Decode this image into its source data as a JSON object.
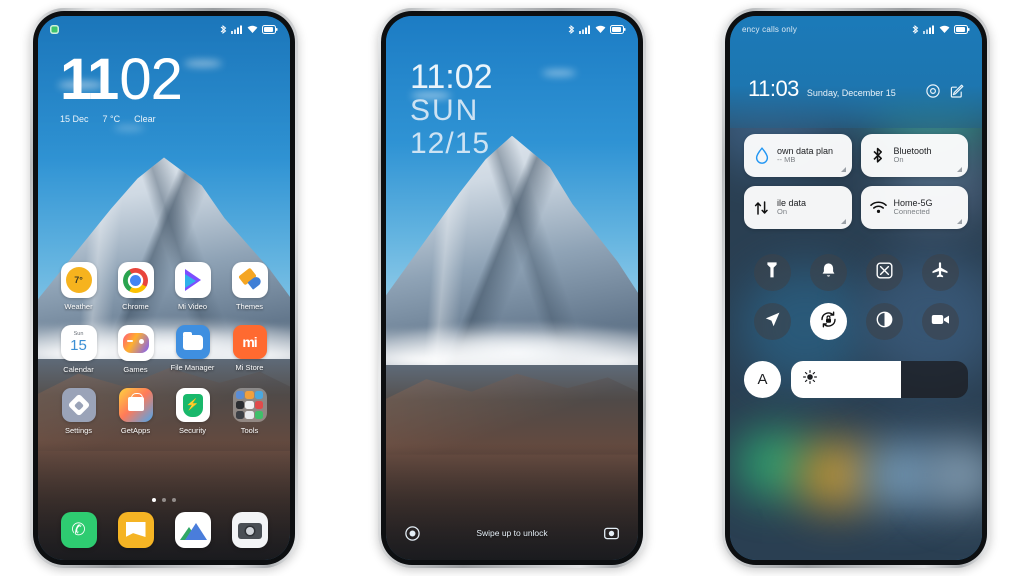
{
  "scene": {
    "background_color": "#ffffff",
    "phone_count": 3
  },
  "phone1": {
    "name": "home-screen",
    "statusbar": {
      "notification_icon": "green-notification-dot",
      "icons": [
        "bluetooth-icon",
        "signal-icon",
        "wifi-icon",
        "battery-icon"
      ]
    },
    "clock_widget": {
      "hour": "11",
      "minute": "02",
      "date": "15 Dec",
      "temperature": "7 °C",
      "condition": "Clear"
    },
    "apps": [
      {
        "label": "Weather",
        "icon": "weather-icon",
        "badge": "7°"
      },
      {
        "label": "Chrome",
        "icon": "chrome-icon"
      },
      {
        "label": "Mi Video",
        "icon": "mi-video-icon"
      },
      {
        "label": "Themes",
        "icon": "themes-icon"
      },
      {
        "label": "Calendar",
        "icon": "calendar-icon",
        "weekday": "Sun",
        "day": "15"
      },
      {
        "label": "Games",
        "icon": "games-icon"
      },
      {
        "label": "File Manager",
        "icon": "file-manager-icon"
      },
      {
        "label": "Mi Store",
        "icon": "mi-store-icon",
        "badge": "mi"
      },
      {
        "label": "Settings",
        "icon": "settings-icon"
      },
      {
        "label": "GetApps",
        "icon": "getapps-icon"
      },
      {
        "label": "Security",
        "icon": "security-icon"
      },
      {
        "label": "Tools",
        "icon": "tools-folder-icon"
      }
    ],
    "page_indicator": {
      "total": 3,
      "active": 1
    },
    "dock": [
      {
        "label": "Phone",
        "icon": "phone-icon"
      },
      {
        "label": "Messages",
        "icon": "messages-icon"
      },
      {
        "label": "Gallery",
        "icon": "gallery-icon"
      },
      {
        "label": "Camera",
        "icon": "camera-icon"
      }
    ]
  },
  "phone2": {
    "name": "lock-screen",
    "statusbar": {
      "icons": [
        "bluetooth-icon",
        "signal-icon",
        "wifi-icon",
        "battery-icon"
      ]
    },
    "lock_clock": {
      "time": "11:02",
      "weekday": "SUN",
      "date": "12/15"
    },
    "bottom_bar": {
      "left_icon": "flashlight-circle-icon",
      "hint": "Swipe up to unlock",
      "right_icon": "camera-icon"
    }
  },
  "phone3": {
    "name": "control-center",
    "statusbar": {
      "carrier": "ency calls only",
      "icons": [
        "bluetooth-icon",
        "signal-icon",
        "wifi-icon",
        "battery-icon"
      ]
    },
    "header": {
      "time": "11:03",
      "date": "Sunday, December 15",
      "actions": [
        "settings-gear-icon",
        "edit-icon"
      ]
    },
    "tiles": [
      {
        "title": "own data plan",
        "subtitle": "-- MB",
        "icon": "data-drop-icon"
      },
      {
        "title": "Bluetooth",
        "subtitle": "On",
        "icon": "bluetooth-icon"
      },
      {
        "title": "ile data",
        "subtitle": "On",
        "icon": "mobile-data-icon"
      },
      {
        "title": "Home-5G",
        "subtitle": "Connected",
        "icon": "wifi-icon"
      }
    ],
    "toggles": [
      {
        "name": "flashlight",
        "icon": "flashlight-icon",
        "active": false
      },
      {
        "name": "ringer",
        "icon": "bell-icon",
        "active": false
      },
      {
        "name": "screenshot",
        "icon": "screenshot-icon",
        "active": false
      },
      {
        "name": "airplane-mode",
        "icon": "airplane-icon",
        "active": false
      },
      {
        "name": "location",
        "icon": "location-arrow-icon",
        "active": false
      },
      {
        "name": "rotation-lock",
        "icon": "rotation-lock-icon",
        "active": true
      },
      {
        "name": "dark-mode",
        "icon": "contrast-icon",
        "active": false
      },
      {
        "name": "screen-recorder",
        "icon": "video-camera-icon",
        "active": false
      }
    ],
    "brightness": {
      "auto_label": "A",
      "icon": "brightness-sun-icon",
      "level_percent": 62
    },
    "drag_handle": "panel-drag-handle"
  },
  "colors": {
    "sky_blue": "#2f93d4",
    "status_blue": "#1b7ab9",
    "accent_white": "#ffffff",
    "frame_silver": "#b9bcbe"
  }
}
